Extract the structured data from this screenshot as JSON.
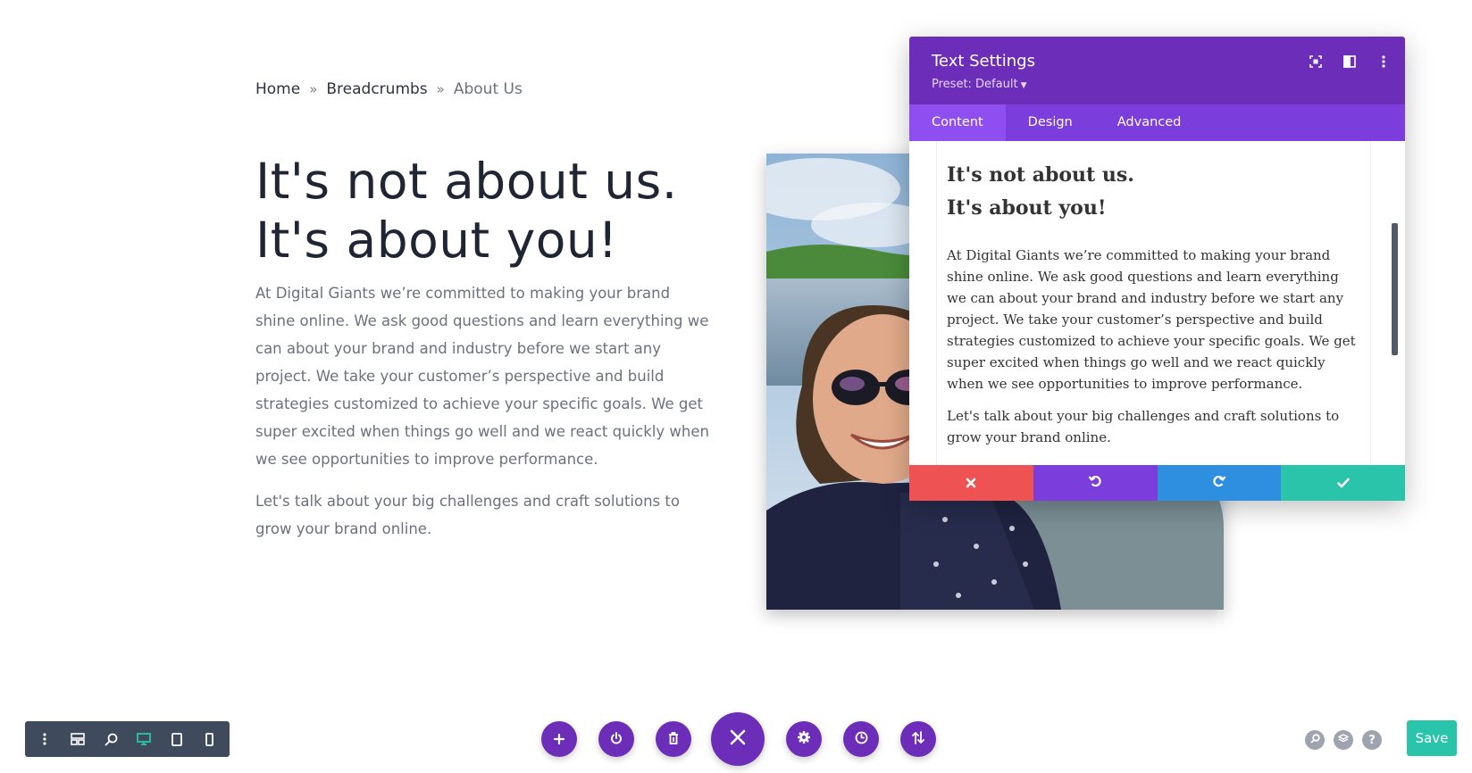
{
  "breadcrumb": {
    "home": "Home",
    "separator1": "»",
    "middle": "Breadcrumbs",
    "separator2": "»",
    "current": "About Us"
  },
  "hero": {
    "title_line1": "It's not about us.",
    "title_line2": "It's about you!",
    "paragraph1": "At Digital Giants we’re committed to making your brand shine online. We ask good questions and learn everything we can about your brand and industry before we start any project. We take your customer’s perspective and build strategies customized to achieve your specific goals. We get super excited when things go well and we react quickly when we see opportunities to improve performance.",
    "paragraph2": "Let's talk about your big challenges and craft solutions to grow your brand online."
  },
  "modal": {
    "title": "Text Settings",
    "preset": "Preset: Default",
    "tabs": [
      {
        "label": "Content",
        "active": true
      },
      {
        "label": "Design",
        "active": false
      },
      {
        "label": "Advanced",
        "active": false
      }
    ],
    "header_icons": [
      "fullscreen-icon",
      "split-view-icon",
      "more-options-icon"
    ],
    "editor": {
      "heading_line1": "It's not about us.",
      "heading_line2": "It's about you!",
      "paragraph1": "At Digital Giants we’re committed to making your brand shine online. We ask good questions and learn everything we can about your brand and industry before we start any project. We take your customer’s perspective and build strategies customized to achieve your specific goals. We get super excited when things go well and we react quickly when we see opportunities to improve performance.",
      "paragraph2": "Let's talk about your big challenges and craft solutions to grow your brand online."
    },
    "actions": [
      {
        "name": "discard",
        "icon": "close-icon",
        "color": "#ef5252"
      },
      {
        "name": "undo",
        "icon": "undo-icon",
        "color": "#7c3ddd"
      },
      {
        "name": "redo",
        "icon": "redo-icon",
        "color": "#2e8ee0"
      },
      {
        "name": "apply",
        "icon": "check-icon",
        "color": "#29c4a9"
      }
    ]
  },
  "view_toolbar": {
    "icons": [
      "more-vertical-icon",
      "wireframe-icon",
      "zoom-icon",
      "desktop-icon",
      "tablet-icon",
      "phone-icon"
    ],
    "active": "desktop-icon"
  },
  "page_actions": {
    "icons": [
      "add-icon",
      "power-icon",
      "trash-icon",
      "close-icon",
      "settings-icon",
      "history-icon",
      "portability-icon"
    ]
  },
  "right_controls": {
    "icons": [
      "search-icon",
      "layers-icon",
      "help-icon"
    ],
    "help_glyph": "?",
    "save_label": "Save"
  },
  "colors": {
    "purple_dark": "#6c2eb9",
    "purple_tabs": "#7c3ddd",
    "red": "#ef5252",
    "blue": "#2e8ee0",
    "teal": "#29c4a9",
    "toolbar": "#3f4a5c"
  }
}
